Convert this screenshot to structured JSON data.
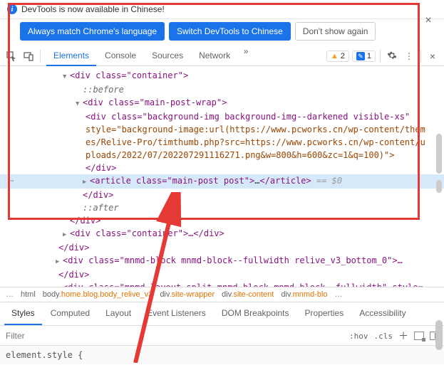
{
  "banner": {
    "message": "DevTools is now available in Chinese!",
    "match_btn": "Always match Chrome's language",
    "switch_btn": "Switch DevTools to Chinese",
    "dismiss_btn": "Don't show again"
  },
  "toolbar": {
    "tabs": {
      "elements": "Elements",
      "console": "Console",
      "sources": "Sources",
      "network": "Network"
    },
    "warn_count": "2",
    "msg_count": "1"
  },
  "dom": {
    "l1_open": "<div class=\"container\">",
    "l2_before": "::before",
    "l3_open": "<div class=\"main-post-wrap\">",
    "l4a": "<div class=\"background-img background-img--darkened visible-xs\"",
    "l4b": "style=\"background-image:url(https://www.pcworks.cn/wp-content/them",
    "l4c": "es/Relive-Pro/timthumb.php?src=https://www.pcworks.cn/wp-content/u",
    "l4d": "ploads/2022/07/202207291116271.png&w=800&h=600&zc=1&q=100)\">",
    "l4e": "</div>",
    "l5_tag_open": "<article class=\"main-post post\">",
    "l5_ell": "…",
    "l5_tag_close": "</article>",
    "l5_eq": " == $0",
    "l6": "</div>",
    "l7_after": "::after",
    "l8": "</div>",
    "l9": "<div class=\"container\">…</div>",
    "l10": "</div>",
    "l11": "<div class=\"mnmd-block mnmd-block--fullwidth relive_v3_bottom_0\">…",
    "l12": "</div>",
    "l13": "<div class=\"mnmd-layout-split mnmd-block mnmd-block--fullwidth\" style="
  },
  "crumbs": {
    "c0": "…",
    "c1": "html",
    "c2_a": "body",
    "c2_b": ".home.blog.body_relive_v3",
    "c3_a": "div",
    "c3_b": ".site-wrapper",
    "c4_a": "div",
    "c4_b": ".site-content",
    "c5_a": "div",
    "c5_b": ".mnmd-blo",
    "c6": "…"
  },
  "subtabs": {
    "styles": "Styles",
    "computed": "Computed",
    "layout": "Layout",
    "listeners": "Event Listeners",
    "dombp": "DOM Breakpoints",
    "props": "Properties",
    "a11y": "Accessibility"
  },
  "filter": {
    "placeholder": "Filter",
    "hov": ":hov",
    "cls": ".cls"
  },
  "code": {
    "line1": "element.style {"
  }
}
